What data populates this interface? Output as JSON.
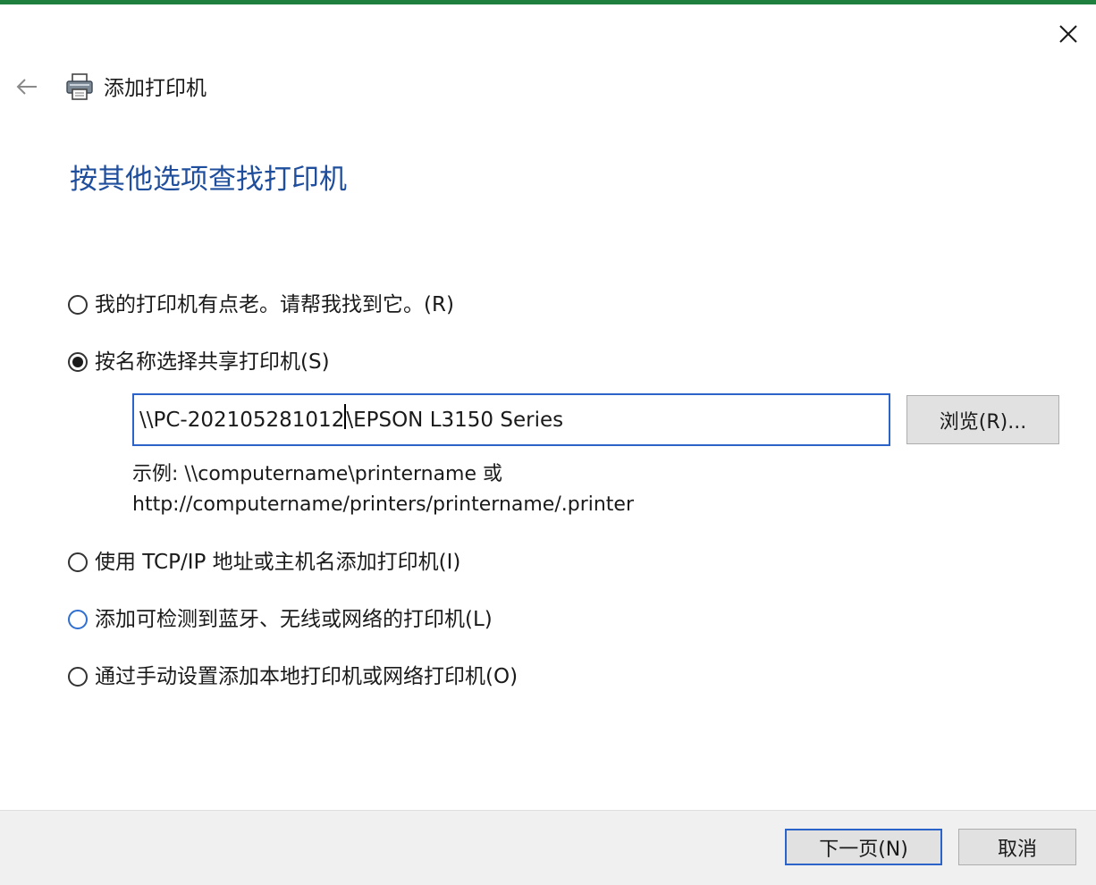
{
  "window": {
    "title": "添加打印机",
    "accent_color": "#1e7f3e"
  },
  "nav": {
    "back_icon": "arrow-left-icon",
    "close_icon": "close-icon",
    "printer_icon": "printer-icon"
  },
  "page": {
    "heading": "按其他选项查找打印机",
    "heading_color": "#1f4e9c"
  },
  "options": [
    {
      "label": "我的打印机有点老。请帮我找到它。(R)",
      "selected": false
    },
    {
      "label": "按名称选择共享打印机(S)",
      "selected": true
    },
    {
      "label": "使用 TCP/IP 地址或主机名添加打印机(I)",
      "selected": false
    },
    {
      "label": "添加可检测到蓝牙、无线或网络的打印机(L)",
      "selected": false
    },
    {
      "label": "通过手动设置添加本地打印机或网络打印机(O)",
      "selected": false
    }
  ],
  "shared_printer": {
    "value_before_caret": "\\\\PC-202105281012",
    "value_after_caret": "\\EPSON L3150 Series",
    "browse_label": "浏览(R)...",
    "example_line1": "示例: \\\\computername\\printername 或",
    "example_line2": "http://computername/printers/printername/.printer"
  },
  "footer": {
    "next_label": "下一页(N)",
    "cancel_label": "取消"
  }
}
